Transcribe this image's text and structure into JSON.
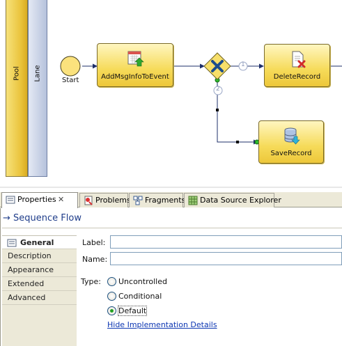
{
  "diagram": {
    "pool_label": "Pool",
    "lane_label": "Lane",
    "start_label": "Start",
    "tasks": [
      {
        "id": "add",
        "label": "AddMsgInfoToEvent",
        "icon": "calendar-task-icon"
      },
      {
        "id": "delete",
        "label": "DeleteRecord",
        "icon": "delete-document-icon"
      },
      {
        "id": "save",
        "label": "SaveRecord",
        "icon": "database-save-icon"
      }
    ],
    "gateway_flow_numbers": [
      "1",
      "2"
    ]
  },
  "tabs": [
    {
      "label": "Properties",
      "icon": "properties-icon",
      "active": true
    },
    {
      "label": "Problems",
      "icon": "problems-icon"
    },
    {
      "label": "Fragments",
      "icon": "fragments-icon"
    },
    {
      "label": "Data Source Explorer",
      "icon": "data-source-explorer-icon"
    }
  ],
  "properties": {
    "title": "Sequence Flow",
    "sidebar": [
      {
        "label": "General",
        "active": true
      },
      {
        "label": "Description"
      },
      {
        "label": "Appearance"
      },
      {
        "label": "Extended"
      },
      {
        "label": "Advanced"
      }
    ],
    "label_field": {
      "label": "Label:",
      "value": ""
    },
    "name_field": {
      "label": "Name:",
      "value": ""
    },
    "type_label": "Type:",
    "type_options": [
      {
        "label": "Uncontrolled",
        "selected": false
      },
      {
        "label": "Conditional",
        "selected": false
      },
      {
        "label": "Default",
        "selected": true
      }
    ],
    "hide_link": "Hide Implementation Details"
  },
  "colors": {
    "task_fill": "#f6db5a",
    "gateway_x": "#1b4d8c",
    "title_blue": "#1f3d8a",
    "link_blue": "#0c36b2"
  }
}
